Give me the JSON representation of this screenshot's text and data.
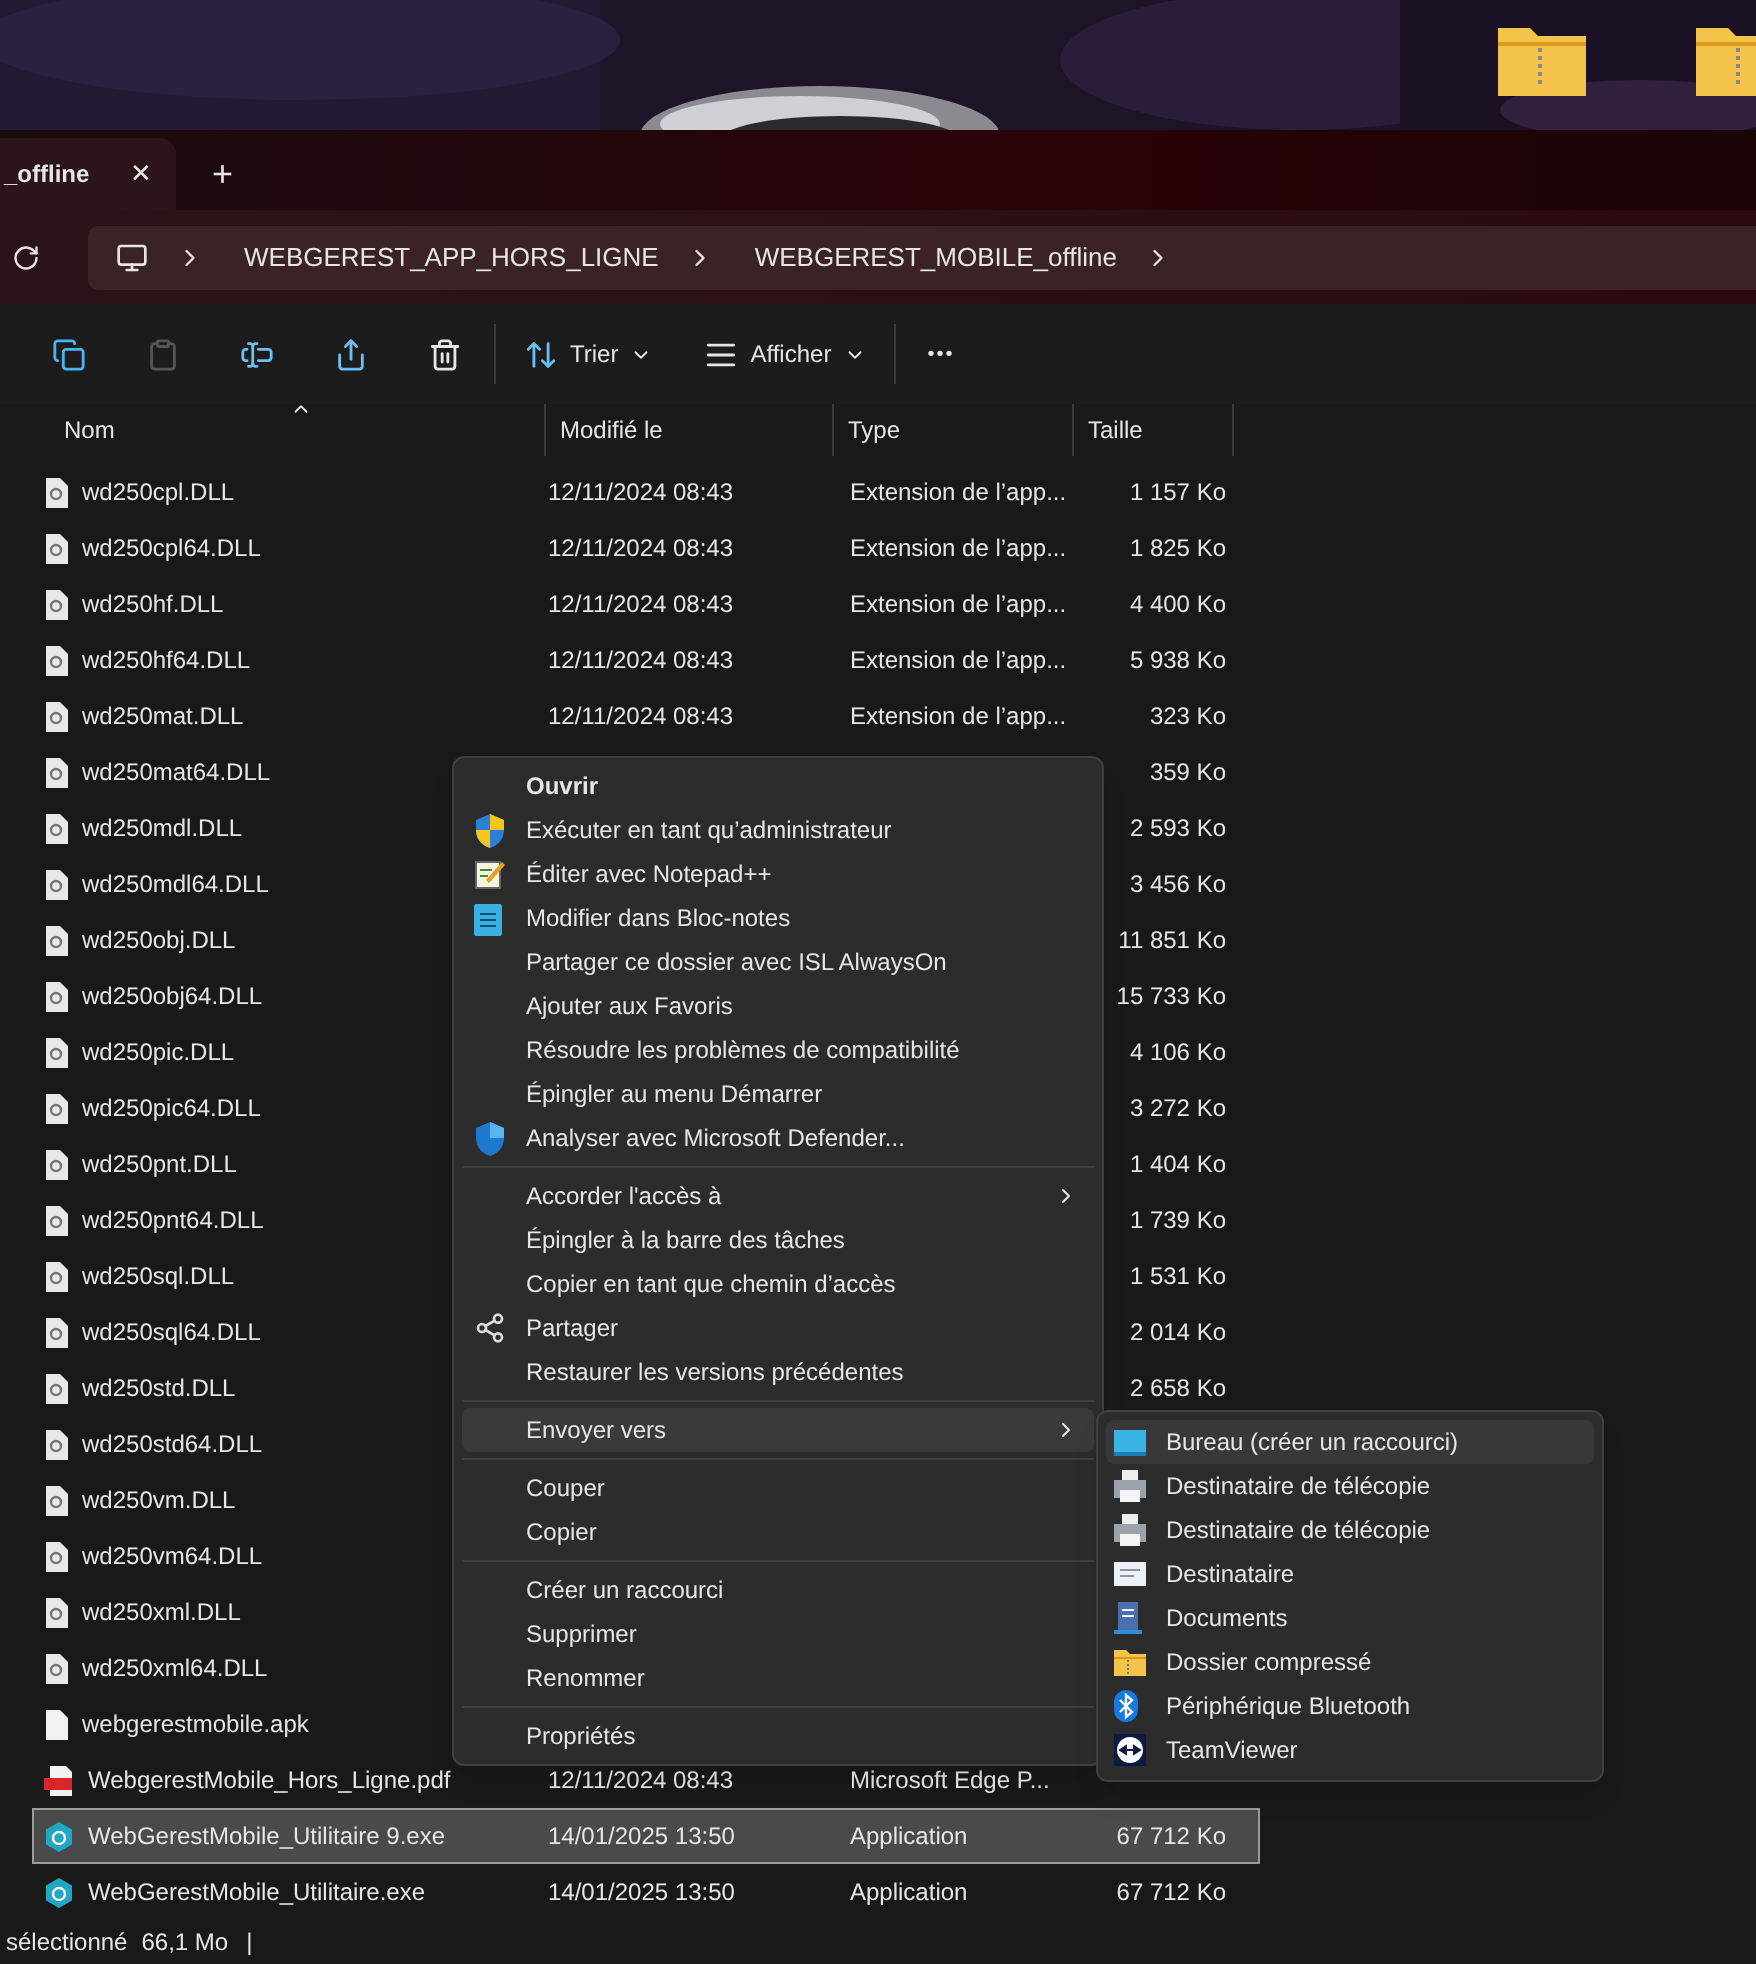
{
  "tab": {
    "title": "_offline",
    "close": "✕",
    "new_tab": "+"
  },
  "breadcrumb": [
    "WEBGEREST_APP_HORS_LIGNE",
    "WEBGEREST_MOBILE_offline"
  ],
  "toolbar": {
    "sort": "Trier",
    "view": "Afficher",
    "more": "•••"
  },
  "columns": [
    {
      "label": "Nom",
      "sorted": true
    },
    {
      "label": "Modifié le",
      "sorted": false
    },
    {
      "label": "Type",
      "sorted": false
    },
    {
      "label": "Taille",
      "sorted": false
    }
  ],
  "rows": [
    {
      "kind": "dll",
      "name": "wd250cpl.DLL",
      "modified": "12/11/2024 08:43",
      "type": "Extension de l’app...",
      "size": "1 157 Ko",
      "selected": false
    },
    {
      "kind": "dll",
      "name": "wd250cpl64.DLL",
      "modified": "12/11/2024 08:43",
      "type": "Extension de l’app...",
      "size": "1 825 Ko",
      "selected": false
    },
    {
      "kind": "dll",
      "name": "wd250hf.DLL",
      "modified": "12/11/2024 08:43",
      "type": "Extension de l’app...",
      "size": "4 400 Ko",
      "selected": false
    },
    {
      "kind": "dll",
      "name": "wd250hf64.DLL",
      "modified": "12/11/2024 08:43",
      "type": "Extension de l’app...",
      "size": "5 938 Ko",
      "selected": false
    },
    {
      "kind": "dll",
      "name": "wd250mat.DLL",
      "modified": "12/11/2024 08:43",
      "type": "Extension de l’app...",
      "size": "323 Ko",
      "selected": false
    },
    {
      "kind": "dll",
      "name": "wd250mat64.DLL",
      "size": "359 Ko",
      "selected": false
    },
    {
      "kind": "dll",
      "name": "wd250mdl.DLL",
      "size": "2 593 Ko",
      "selected": false
    },
    {
      "kind": "dll",
      "name": "wd250mdl64.DLL",
      "size": "3 456 Ko",
      "selected": false
    },
    {
      "kind": "dll",
      "name": "wd250obj.DLL",
      "size": "11 851 Ko",
      "selected": false
    },
    {
      "kind": "dll",
      "name": "wd250obj64.DLL",
      "size": "15 733 Ko",
      "selected": false
    },
    {
      "kind": "dll",
      "name": "wd250pic.DLL",
      "size": "4 106 Ko",
      "selected": false
    },
    {
      "kind": "dll",
      "name": "wd250pic64.DLL",
      "size": "3 272 Ko",
      "selected": false
    },
    {
      "kind": "dll",
      "name": "wd250pnt.DLL",
      "size": "1 404 Ko",
      "selected": false
    },
    {
      "kind": "dll",
      "name": "wd250pnt64.DLL",
      "size": "1 739 Ko",
      "selected": false
    },
    {
      "kind": "dll",
      "name": "wd250sql.DLL",
      "size": "1 531 Ko",
      "selected": false
    },
    {
      "kind": "dll",
      "name": "wd250sql64.DLL",
      "size": "2 014 Ko",
      "selected": false
    },
    {
      "kind": "dll",
      "name": "wd250std.DLL",
      "size": "2 658 Ko",
      "selected": false
    },
    {
      "kind": "dll",
      "name": "wd250std64.DLL",
      "selected": false
    },
    {
      "kind": "dll",
      "name": "wd250vm.DLL",
      "selected": false
    },
    {
      "kind": "dll",
      "name": "wd250vm64.DLL",
      "selected": false
    },
    {
      "kind": "dll",
      "name": "wd250xml.DLL",
      "selected": false
    },
    {
      "kind": "dll",
      "name": "wd250xml64.DLL",
      "selected": false
    },
    {
      "kind": "file",
      "name": "webgerestmobile.apk",
      "selected": false
    },
    {
      "kind": "pdf",
      "name": "WebgerestMobile_Hors_Ligne.pdf",
      "modified": "12/11/2024 08:43",
      "type": "Microsoft Edge P...",
      "selected": false
    },
    {
      "kind": "exe",
      "name": "WebGerestMobile_Utilitaire 9.exe",
      "modified": "14/01/2025 13:50",
      "type": "Application",
      "size": "67 712 Ko",
      "selected": true
    },
    {
      "kind": "exe",
      "name": "WebGerestMobile_Utilitaire.exe",
      "modified": "14/01/2025 13:50",
      "type": "Application",
      "size": "67 712 Ko",
      "selected": false
    }
  ],
  "status_bar": {
    "selection": "sélectionné",
    "size": "66,1 Mo",
    "divider": "|"
  },
  "context_menu": [
    [
      {
        "kind": "default",
        "label": "Ouvrir"
      },
      {
        "kind": "uac",
        "label": "Exécuter en tant qu’administrateur"
      },
      {
        "kind": "notepadplus",
        "label": "Éditer avec Notepad++"
      },
      {
        "kind": "notepad",
        "label": "Modifier dans Bloc-notes"
      },
      {
        "kind": "plain",
        "label": "Partager ce dossier avec ISL AlwaysOn"
      },
      {
        "kind": "plain",
        "label": "Ajouter aux Favoris"
      },
      {
        "kind": "plain",
        "label": "Résoudre les problèmes de compatibilité"
      },
      {
        "kind": "plain",
        "label": "Épingler au menu Démarrer"
      },
      {
        "kind": "defender",
        "label": "Analyser avec Microsoft Defender..."
      }
    ],
    [
      {
        "kind": "submenu",
        "label": "Accorder l'accès à",
        "expanded": false
      },
      {
        "kind": "plain",
        "label": "Épingler à la barre des tâches"
      },
      {
        "kind": "plain",
        "label": "Copier en tant que chemin d’accès"
      },
      {
        "kind": "share",
        "label": "Partager"
      },
      {
        "kind": "plain",
        "label": "Restaurer les versions précédentes"
      }
    ],
    [
      {
        "kind": "submenu",
        "label": "Envoyer vers",
        "expanded": true
      }
    ],
    [
      {
        "kind": "plain",
        "label": "Couper"
      },
      {
        "kind": "plain",
        "label": "Copier"
      }
    ],
    [
      {
        "kind": "plain",
        "label": "Créer un raccourci"
      },
      {
        "kind": "plain",
        "label": "Supprimer"
      },
      {
        "kind": "plain",
        "label": "Renommer"
      }
    ],
    [
      {
        "kind": "plain",
        "label": "Propriétés"
      }
    ]
  ],
  "send_to_menu": [
    {
      "kind": "desktop",
      "label": "Bureau (créer un raccourci)",
      "selected": true
    },
    {
      "kind": "fax",
      "label": "Destinataire de télécopie",
      "selected": false
    },
    {
      "kind": "fax",
      "label": "Destinataire de télécopie",
      "selected": false
    },
    {
      "kind": "mail",
      "label": "Destinataire",
      "selected": false
    },
    {
      "kind": "documents",
      "label": "Documents",
      "selected": false
    },
    {
      "kind": "zip",
      "label": "Dossier compressé",
      "selected": false
    },
    {
      "kind": "bluetooth",
      "label": "Périphérique Bluetooth",
      "selected": false
    },
    {
      "kind": "teamviewer",
      "label": "TeamViewer",
      "selected": false
    }
  ]
}
